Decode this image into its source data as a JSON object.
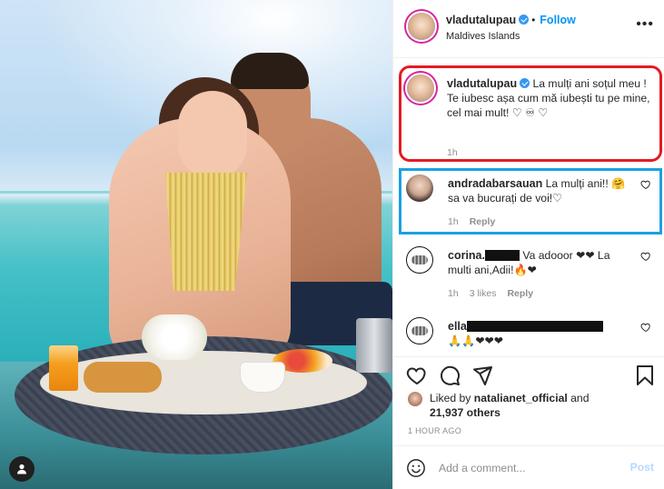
{
  "post": {
    "username": "vladutalupau",
    "follow_label": "Follow",
    "dot": "•",
    "location": "Maldives Islands",
    "more_label": "•••"
  },
  "caption": {
    "username": "vladutalupau",
    "text_line1": "La mulți ani soțul meu !",
    "text_line2": "Te iubesc așa cum mă iubești tu pe mine, cel mai mult! ♡ ♾ ♡",
    "time": "1h"
  },
  "comments": [
    {
      "username": "andradabarsauan",
      "text": "La mulți ani!! 🤗 sa va bucurați de voi!♡",
      "time": "1h",
      "likes": "",
      "reply_label": "Reply"
    },
    {
      "username": "corina.",
      "text": "Va adooor ❤❤ La multi ani,Adii!🔥❤",
      "time": "1h",
      "likes": "3 likes",
      "reply_label": "Reply"
    },
    {
      "username": "ella",
      "text": "🙏🙏❤❤❤"
    }
  ],
  "likes": {
    "liked_by_prefix": "Liked by",
    "liked_by_user": "natalianet_official",
    "and": "and",
    "others": "21,937 others"
  },
  "timeago": "1 HOUR AGO",
  "add_comment": {
    "placeholder": "Add a comment...",
    "post_label": "Post"
  },
  "colors": {
    "accent_blue": "#0095f6",
    "caption_highlight": "#e41b23",
    "comment_highlight": "#1ca0e3",
    "heart_red": "#ed1c3a"
  }
}
